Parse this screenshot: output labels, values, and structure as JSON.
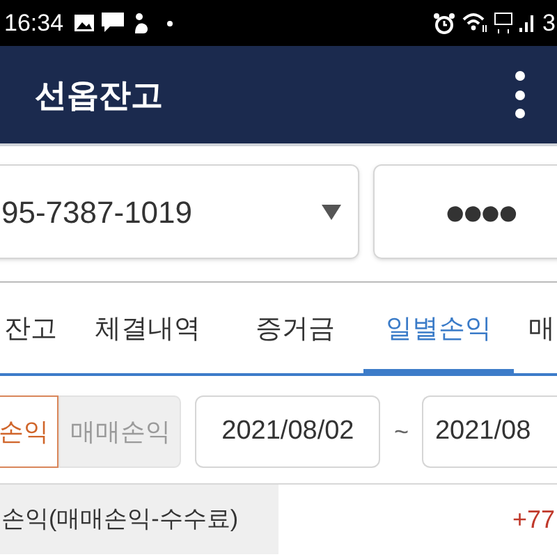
{
  "status_bar": {
    "time": "16:34",
    "battery": "3"
  },
  "app_bar": {
    "title": "선옵잔고"
  },
  "account": {
    "value": "95-7387-1019",
    "password": "●●●●"
  },
  "tabs": [
    {
      "label": "잔고",
      "selected": false
    },
    {
      "label": "체결내역",
      "selected": false
    },
    {
      "label": "증거금",
      "selected": false
    },
    {
      "label": "일별손익",
      "selected": true
    },
    {
      "label": "매",
      "selected": false
    }
  ],
  "modes": [
    {
      "label": "손익",
      "selected": true
    },
    {
      "label": "매매손익",
      "selected": false
    }
  ],
  "date_range": {
    "from": "2021/08/02",
    "separator": "~",
    "to": "2021/08"
  },
  "summary": {
    "label": "손익(매매손익-수수료)",
    "value": "+77"
  }
}
